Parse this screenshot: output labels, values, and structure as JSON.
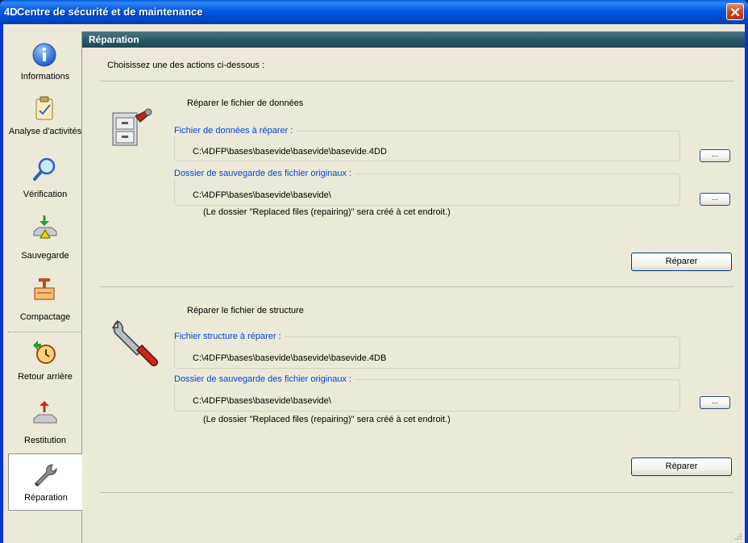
{
  "window": {
    "title": "Centre de sécurité et de maintenance",
    "app_logo": "4D"
  },
  "sidebar": {
    "items": [
      {
        "label": "Informations",
        "icon": "info-icon"
      },
      {
        "label": "Analyse d'activités",
        "icon": "analysis-icon"
      },
      {
        "label": "Vérification",
        "icon": "magnifier-icon"
      },
      {
        "label": "Sauvegarde",
        "icon": "backup-icon"
      },
      {
        "label": "Compactage",
        "icon": "compact-icon"
      },
      {
        "label": "Retour arrière",
        "icon": "rollback-icon"
      },
      {
        "label": "Restitution",
        "icon": "restore-icon"
      },
      {
        "label": "Réparation",
        "icon": "wrench-icon"
      }
    ],
    "active": "Réparation"
  },
  "main": {
    "header": "Réparation",
    "intro": "Choisissez une des actions ci-dessous :",
    "data_block": {
      "title": "Réparer le fichier de données",
      "file_legend": "Fichier de données à réparer :",
      "file_path": "C:\\4DFP\\bases\\basevide\\basevide\\basevide.4DD",
      "backup_legend": "Dossier de sauvegarde des fichier originaux :",
      "backup_path": "C:\\4DFP\\bases\\basevide\\basevide\\",
      "note": "(Le dossier \"Replaced files (repairing)\" sera créé à cet endroit.)",
      "browse_label": "...",
      "repair_label": "Réparer"
    },
    "structure_block": {
      "title": "Réparer le fichier de structure",
      "file_legend": "Fichier structure à réparer :",
      "file_path": "C:\\4DFP\\bases\\basevide\\basevide\\basevide.4DB",
      "backup_legend": "Dossier de sauvegarde des fichier originaux :",
      "backup_path": "C:\\4DFP\\bases\\basevide\\basevide\\",
      "note": "(Le dossier \"Replaced files (repairing)\" sera créé à cet endroit.)",
      "browse_label": "...",
      "repair_label": "Réparer"
    }
  },
  "colors": {
    "titlebar": "#0058e6",
    "section_header": "#2e5a6a",
    "legend": "#0046d5",
    "background": "#ece9d8"
  }
}
